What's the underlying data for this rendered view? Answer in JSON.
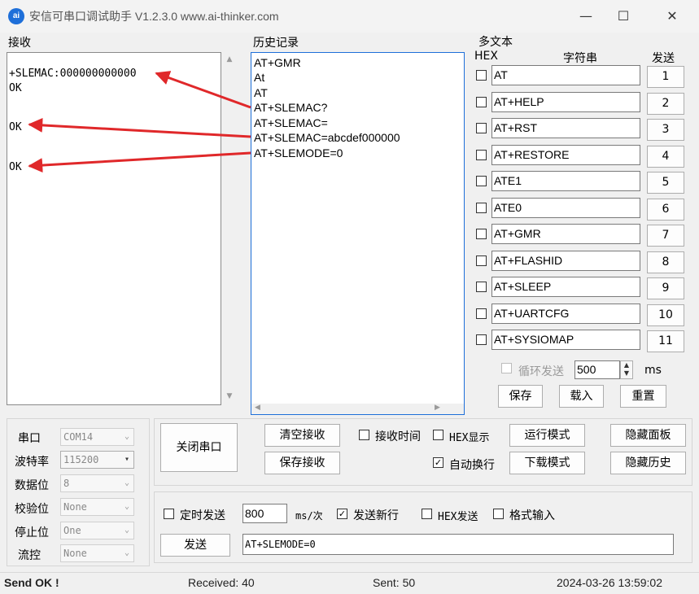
{
  "titlebar": {
    "app_icon": "ai",
    "title": "安信可串口调试助手 V1.2.3.0    www.ai-thinker.com",
    "minimize": "—",
    "maximize": "☐",
    "close": "✕"
  },
  "receive": {
    "label": "接收",
    "lines": [
      "+SLEMAC:000000000000",
      "OK",
      "OK",
      "OK"
    ]
  },
  "history": {
    "label": "历史记录",
    "items": [
      "AT+GMR",
      "At",
      "AT",
      "AT+SLEMAC?",
      "AT+SLEMAC=",
      "AT+SLEMAC=abcdef000000",
      "AT+SLEMODE=0"
    ]
  },
  "multitext": {
    "label": "多文本",
    "col_hex": "HEX",
    "col_string": "字符串",
    "col_send": "发送",
    "rows": [
      {
        "text": "AT",
        "num": "1"
      },
      {
        "text": "AT+HELP",
        "num": "2"
      },
      {
        "text": "AT+RST",
        "num": "3"
      },
      {
        "text": "AT+RESTORE",
        "num": "4"
      },
      {
        "text": "ATE1",
        "num": "5"
      },
      {
        "text": "ATE0",
        "num": "6"
      },
      {
        "text": "AT+GMR",
        "num": "7"
      },
      {
        "text": "AT+FLASHID",
        "num": "8"
      },
      {
        "text": "AT+SLEEP",
        "num": "9"
      },
      {
        "text": "AT+UARTCFG",
        "num": "10"
      },
      {
        "text": "AT+SYSIOMAP",
        "num": "11"
      }
    ],
    "loop_label": "循环发送",
    "loop_interval": "500",
    "loop_unit": "ms",
    "save": "保存",
    "load": "载入",
    "reset": "重置"
  },
  "serial": {
    "port_label": "串口",
    "port_value": "COM14",
    "baud_label": "波特率",
    "baud_value": "115200",
    "databits_label": "数据位",
    "databits_value": "8",
    "parity_label": "校验位",
    "parity_value": "None",
    "stopbits_label": "停止位",
    "stopbits_value": "One",
    "flow_label": "流控",
    "flow_value": "None"
  },
  "controls": {
    "close_port": "关闭串口",
    "clear_recv": "清空接收",
    "save_recv": "保存接收",
    "recv_time": "接收时间",
    "hex_display": "HEX显示",
    "auto_wrap": "自动换行",
    "run_mode": "运行模式",
    "download_mode": "下载模式",
    "hide_panel": "隐藏面板",
    "hide_history": "隐藏历史"
  },
  "send": {
    "timed_send": "定时发送",
    "interval": "800",
    "unit": "ms/次",
    "send_newline": "发送新行",
    "hex_send": "HEX发送",
    "format_input": "格式输入",
    "send_button": "发送",
    "input_value": "AT+SLEMODE=0"
  },
  "status": {
    "message": "Send OK !",
    "received": "Received: 40",
    "sent": "Sent: 50",
    "datetime": "2024-03-26 13:59:02"
  },
  "colors": {
    "accent": "#1e6fd9",
    "arrow": "#e0282a"
  }
}
